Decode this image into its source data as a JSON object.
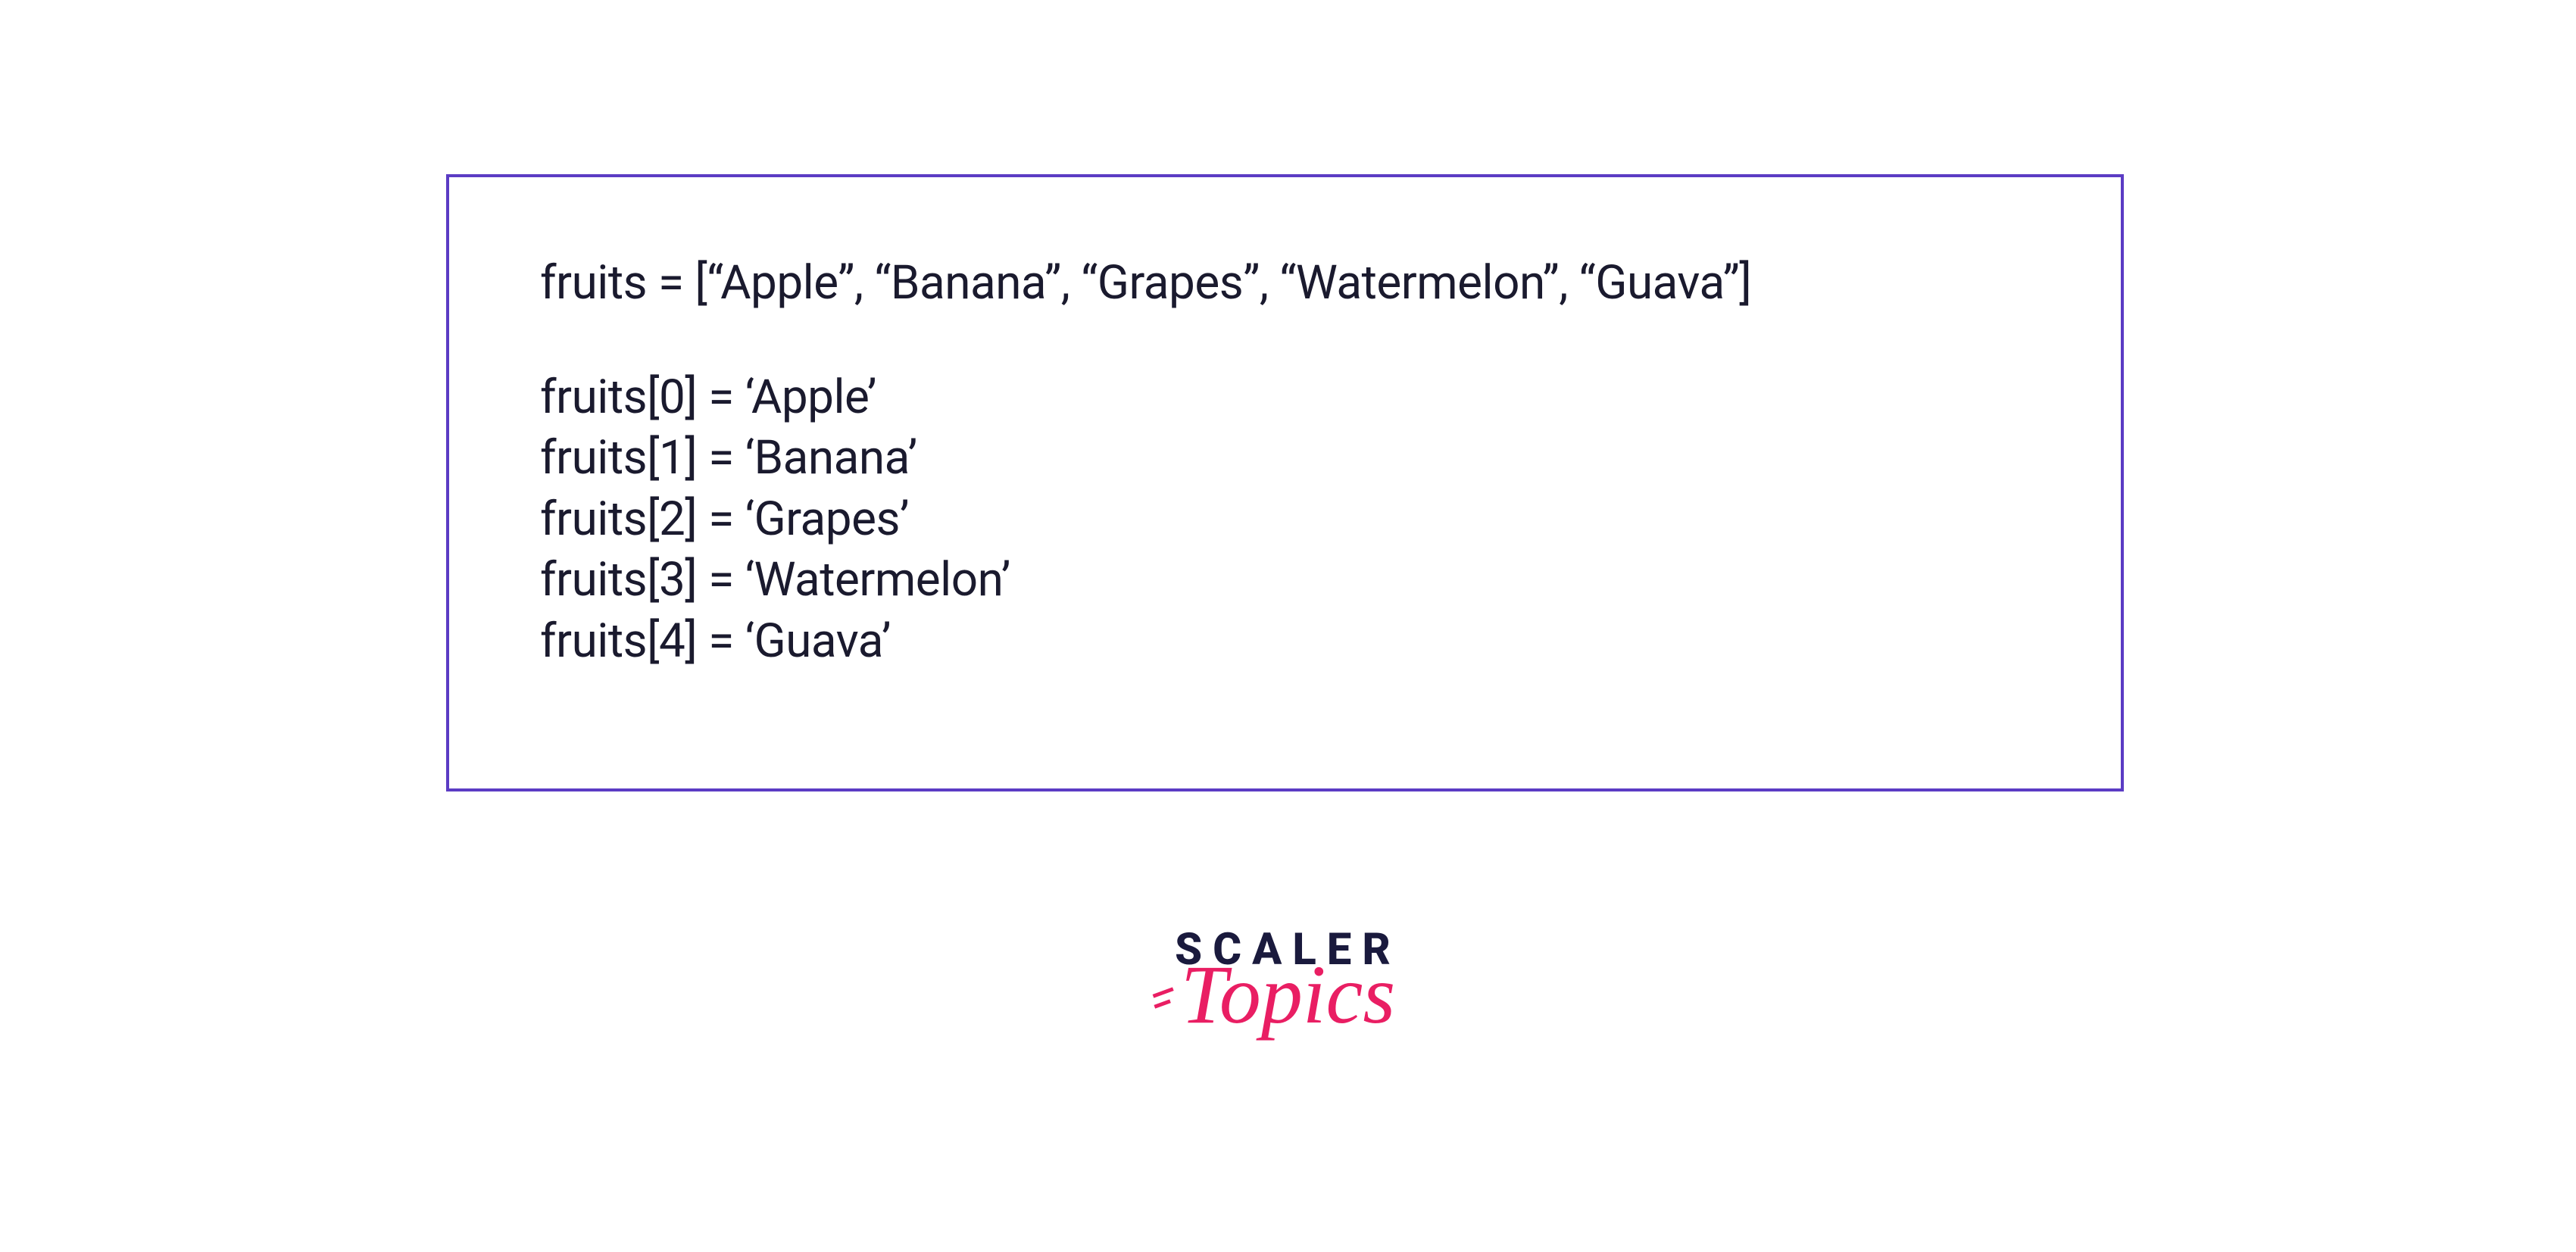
{
  "code": {
    "declaration": "fruits = [“Apple”, “Banana”, “Grapes”, “Watermelon”, “Guava”]",
    "indices": [
      "fruits[0] = ‘Apple’",
      "fruits[1] = ‘Banana’",
      "fruits[2] = ‘Grapes’",
      "fruits[3] = ‘Watermelon’",
      "fruits[4] = ‘Guava’"
    ]
  },
  "logo": {
    "line1": "SCALER",
    "line2": "Topics"
  }
}
